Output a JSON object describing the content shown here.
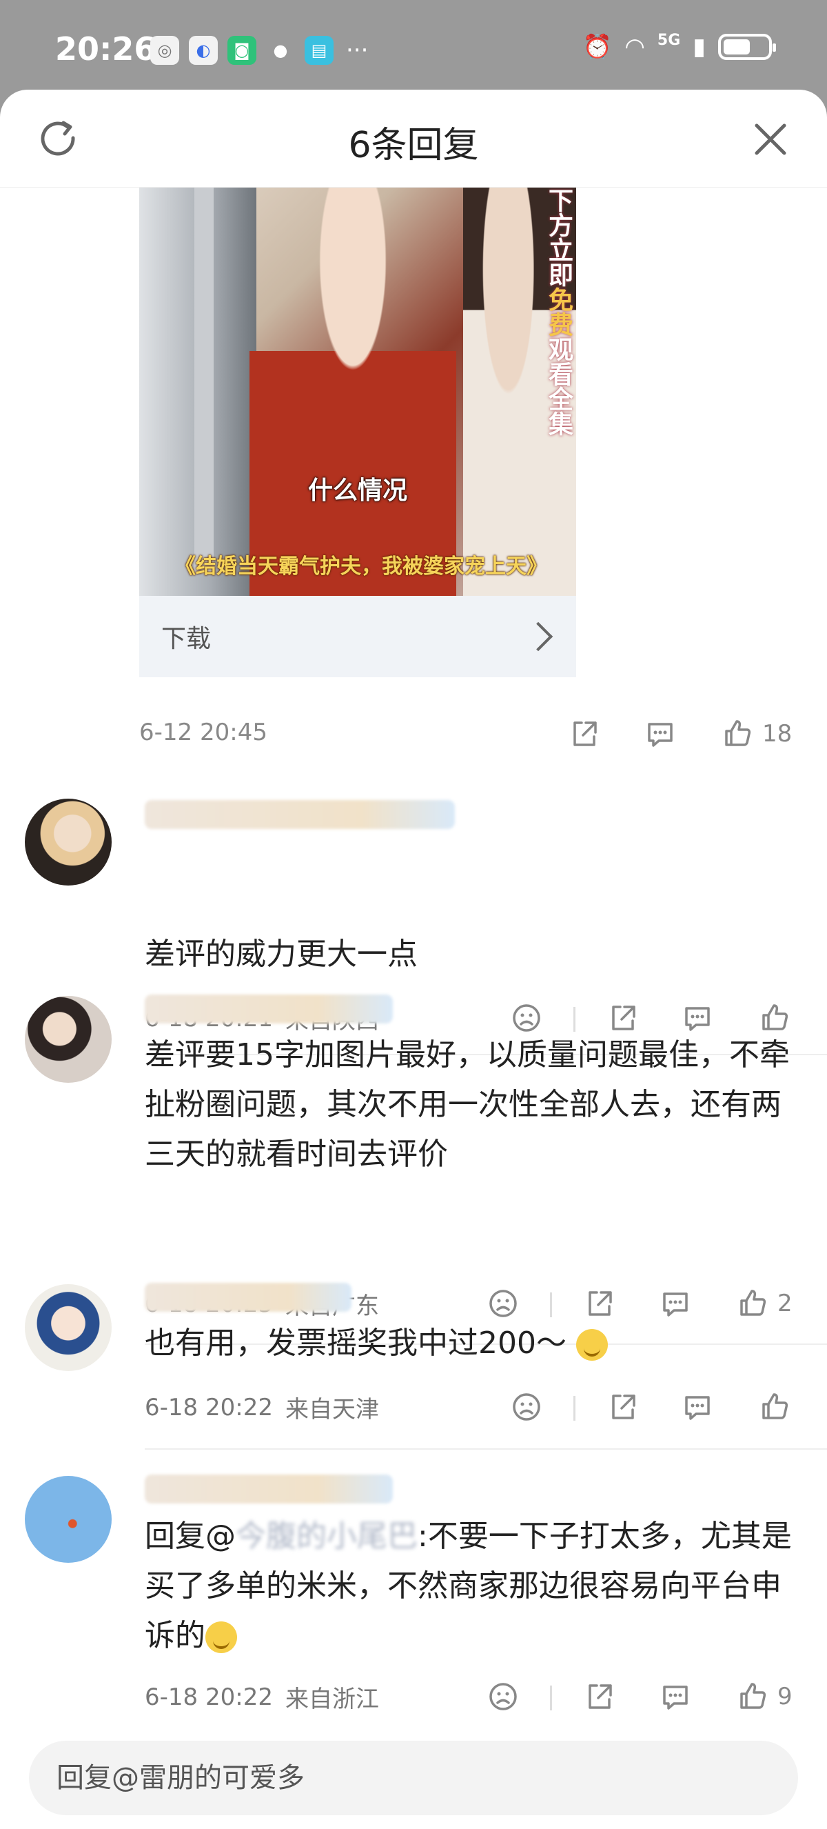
{
  "status_bar": {
    "time": "20:26",
    "dots": "···",
    "network": "5G"
  },
  "header": {
    "title": "6条回复"
  },
  "ad": {
    "side_text_a": "下方立即",
    "side_text_b": "免费",
    "side_text_c": "观看全集",
    "subtitle": "什么情况",
    "caption": "《结婚当天霸气护夫，我被婆家宠上天》",
    "download_label": "下载",
    "time": "6-12 20:45",
    "likes": "18"
  },
  "comments": [
    {
      "text": "差评的威力更大一点",
      "time": "6-18 20:21",
      "location": "来自陕西",
      "likes": ""
    },
    {
      "text": "差评要15字加图片最好，以质量问题最佳，不牵扯粉圈问题，其次不用一次性全部人去，还有两三天的就看时间去评价",
      "time": "6-18 20:23",
      "location": "来自广东",
      "likes": "2"
    },
    {
      "text": "也有用，发票摇奖我中过200～",
      "time": "6-18 20:22",
      "location": "来自天津",
      "likes": ""
    },
    {
      "reply_prefix": "回复@",
      "reply_blurred": "今腹的小尾巴",
      "reply_suffix": ":不要一下子打太多，尤其是买了多单的米米，不然商家那边很容易向平台申诉的",
      "time": "6-18 20:22",
      "location": "来自浙江",
      "likes": "9"
    }
  ],
  "reply_input": {
    "placeholder": "回复@雷朋的可爱多"
  },
  "colors": {
    "accent_link": "#2d5a9a",
    "caption_gold": "#f6d45a"
  }
}
